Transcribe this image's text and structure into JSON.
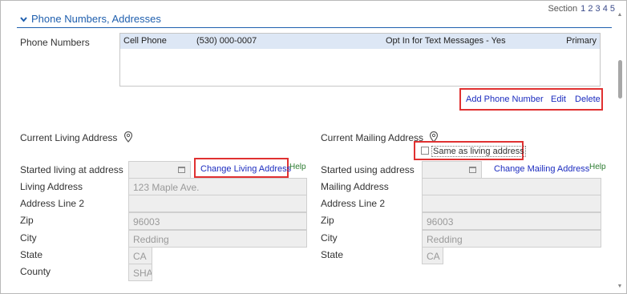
{
  "section_nav": {
    "label": "Section",
    "numbers": "1 2 3 4 5"
  },
  "section": {
    "title": "Phone Numbers, Addresses"
  },
  "phone_numbers": {
    "label": "Phone Numbers",
    "rows": [
      {
        "type": "Cell Phone",
        "number": "(530) 000-0007",
        "opt_in": "Opt In for Text Messages - Yes",
        "status": "Primary"
      }
    ],
    "actions": {
      "add": "Add Phone Number",
      "edit": "Edit",
      "delete": "Delete"
    }
  },
  "living": {
    "header": "Current Living Address",
    "started_label": "Started living at address",
    "change_link": "Change Living Address",
    "help": "Help",
    "address_label": "Living Address",
    "address_value": "123 Maple Ave.",
    "line2_label": "Address Line 2",
    "line2_value": "",
    "zip_label": "Zip",
    "zip_value": "96003",
    "city_label": "City",
    "city_value": "Redding",
    "state_label": "State",
    "state_value": "CA",
    "county_label": "County",
    "county_value": "SHA"
  },
  "mailing": {
    "header": "Current Mailing Address",
    "same_as_label": "Same as living address",
    "same_as_checked": false,
    "started_label": "Started using address",
    "change_link": "Change Mailing Address",
    "help": "Help",
    "address_label": "Mailing Address",
    "address_value": "",
    "line2_label": "Address Line 2",
    "line2_value": "",
    "zip_label": "Zip",
    "zip_value": "96003",
    "city_label": "City",
    "city_value": "Redding",
    "state_label": "State",
    "state_value": "CA"
  },
  "colors": {
    "link": "#1b2bbf",
    "header": "#1f5fae",
    "highlight": "#e03131",
    "help": "#2e7d32",
    "row_bg": "#dde7f5"
  },
  "icons": {
    "section_toggle": "chevron-down-icon",
    "location": "map-pin-icon",
    "calendar": "calendar-icon"
  }
}
